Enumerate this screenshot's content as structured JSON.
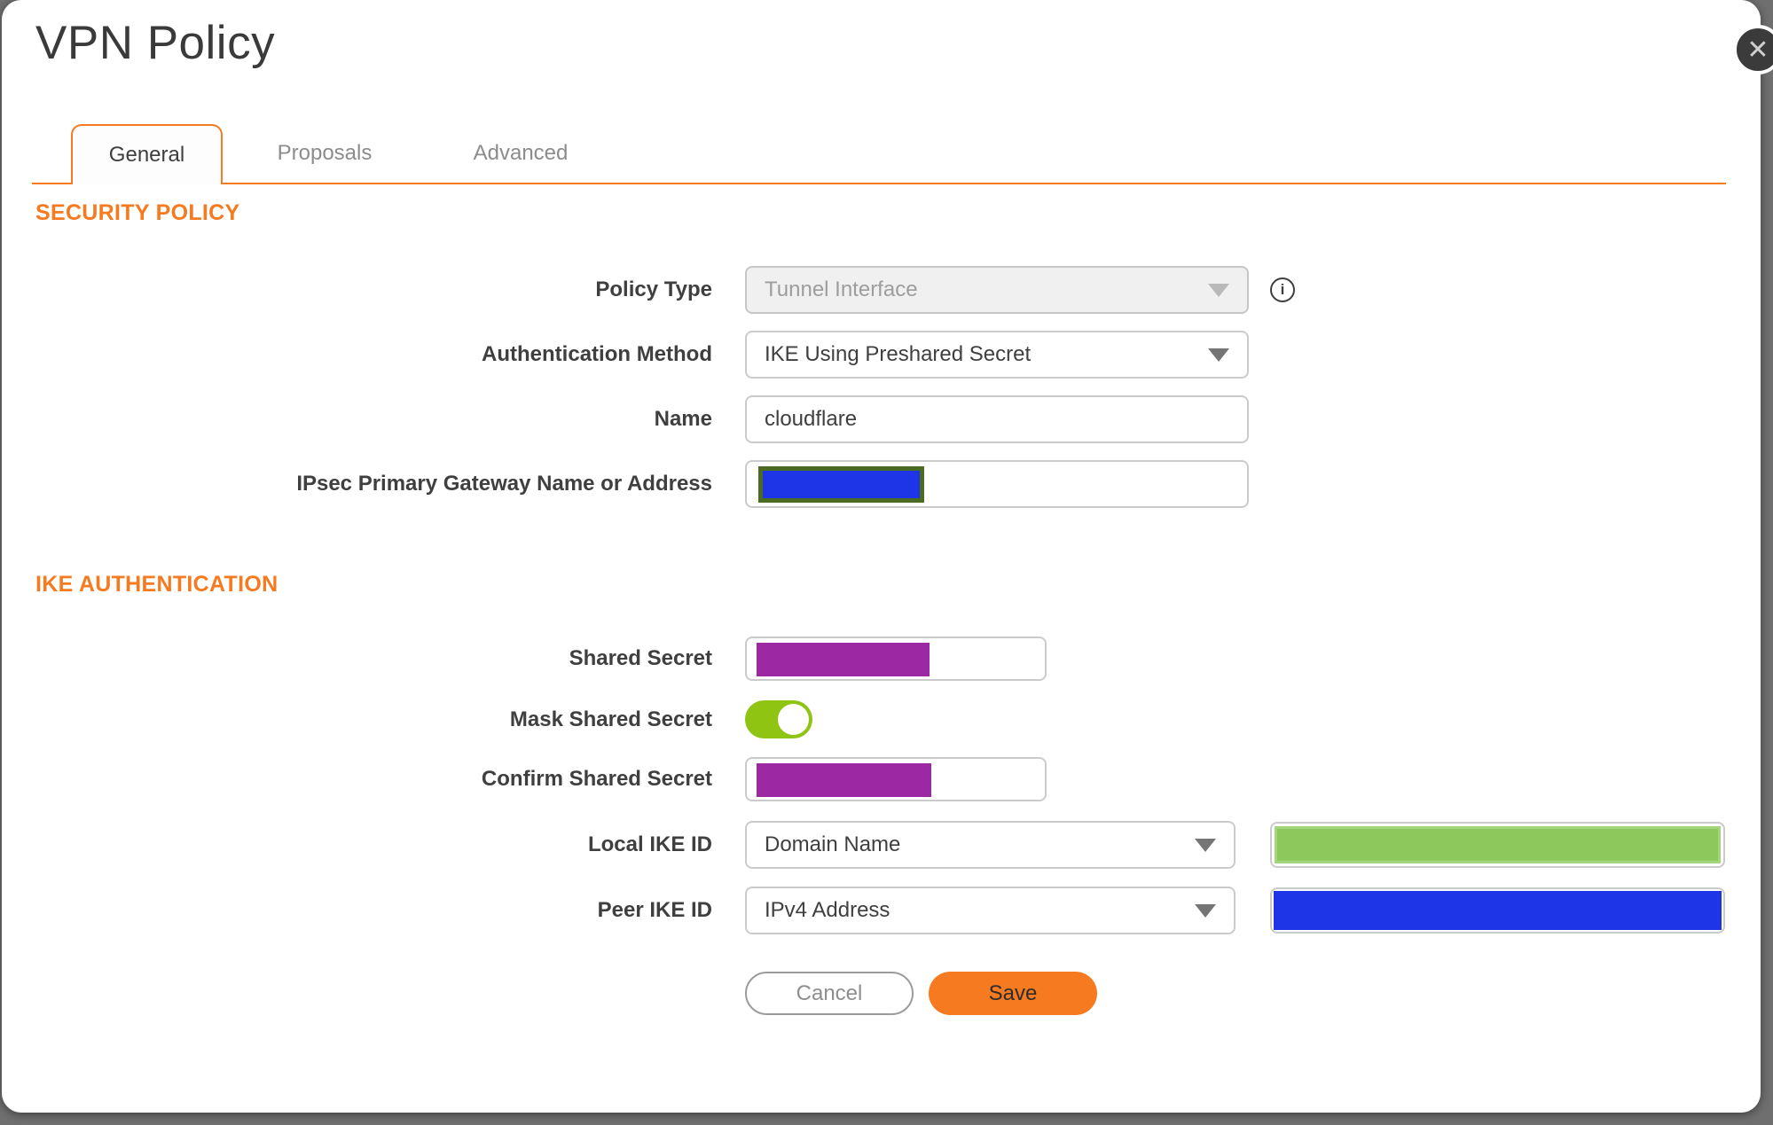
{
  "window": {
    "title": "VPN Policy"
  },
  "icons": {
    "close": "✕",
    "info": "i"
  },
  "tabs": [
    {
      "label": "General",
      "active": true
    },
    {
      "label": "Proposals",
      "active": false
    },
    {
      "label": "Advanced",
      "active": false
    }
  ],
  "sections": {
    "security_policy": "SECURITY POLICY",
    "ike_authentication": "IKE AUTHENTICATION"
  },
  "fields": {
    "policy_type": {
      "label": "Policy Type",
      "value": "Tunnel Interface",
      "disabled": true
    },
    "auth_method": {
      "label": "Authentication Method",
      "value": "IKE Using Preshared Secret"
    },
    "name": {
      "label": "Name",
      "value": "cloudflare"
    },
    "gateway": {
      "label": "IPsec Primary Gateway Name or Address",
      "value": "",
      "redacted": true
    },
    "shared_secret": {
      "label": "Shared Secret",
      "value": "",
      "redacted": true
    },
    "mask_shared_secret": {
      "label": "Mask Shared Secret",
      "state": "on"
    },
    "confirm_shared_secret": {
      "label": "Confirm Shared Secret",
      "value": "",
      "redacted": true
    },
    "local_ike_id": {
      "label": "Local IKE ID",
      "value": "Domain Name",
      "id_value_redacted": true
    },
    "peer_ike_id": {
      "label": "Peer IKE ID",
      "value": "IPv4 Address",
      "id_value_redacted": true
    }
  },
  "buttons": {
    "cancel": "Cancel",
    "save": "Save"
  },
  "colors": {
    "accent": "#f57a20",
    "toggle_green": "#8fc413",
    "redact_purple": "#9d28a4",
    "redact_blue": "#1e34e7",
    "redact_olive": "#4c6b22",
    "redact_green": "#8cc85c",
    "redact_green_border": "#a3d57e"
  }
}
